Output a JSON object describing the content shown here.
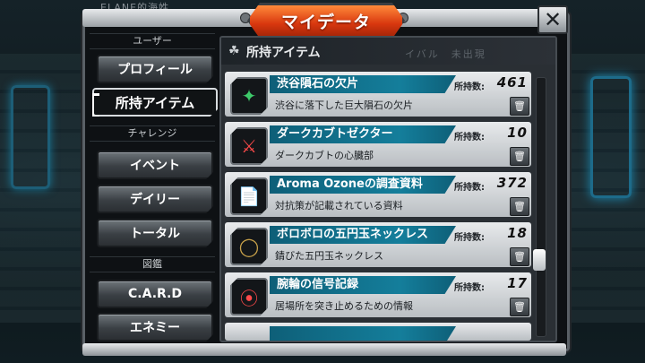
{
  "screen_title": "マイデータ",
  "background_tag": "ELANE的海姓",
  "close_symbol": "✕",
  "sidebar": {
    "section_user": "ユーザー",
    "profile": "プロフィール",
    "items": "所持アイテム",
    "section_challenge": "チャレンジ",
    "event": "イベント",
    "daily": "デイリー",
    "total": "トータル",
    "section_encyclopedia": "図鑑",
    "card": "C.A.R.D",
    "enemy": "エネミー"
  },
  "main": {
    "title": "所持アイテム",
    "ghost_text": "イバル　未出現",
    "count_label": "所持数:",
    "items": [
      {
        "name": "渋谷隕石の欠片",
        "count": "461",
        "desc": "渋谷に落下した巨大隕石の欠片",
        "icon": "green-stone-icon"
      },
      {
        "name": "ダークカブトゼクター",
        "count": "10",
        "desc": "ダークカブトの心臓部",
        "icon": "zecter-icon"
      },
      {
        "name": "Aroma Ozoneの調査資料",
        "count": "372",
        "desc": "対抗策が記載されている資料",
        "icon": "document-icon"
      },
      {
        "name": "ボロボロの五円玉ネックレス",
        "count": "18",
        "desc": "錆びた五円玉ネックレス",
        "icon": "necklace-icon"
      },
      {
        "name": "腕輪の信号記録",
        "count": "17",
        "desc": "居場所を突き止めるための情報",
        "icon": "bracelet-icon"
      }
    ]
  }
}
